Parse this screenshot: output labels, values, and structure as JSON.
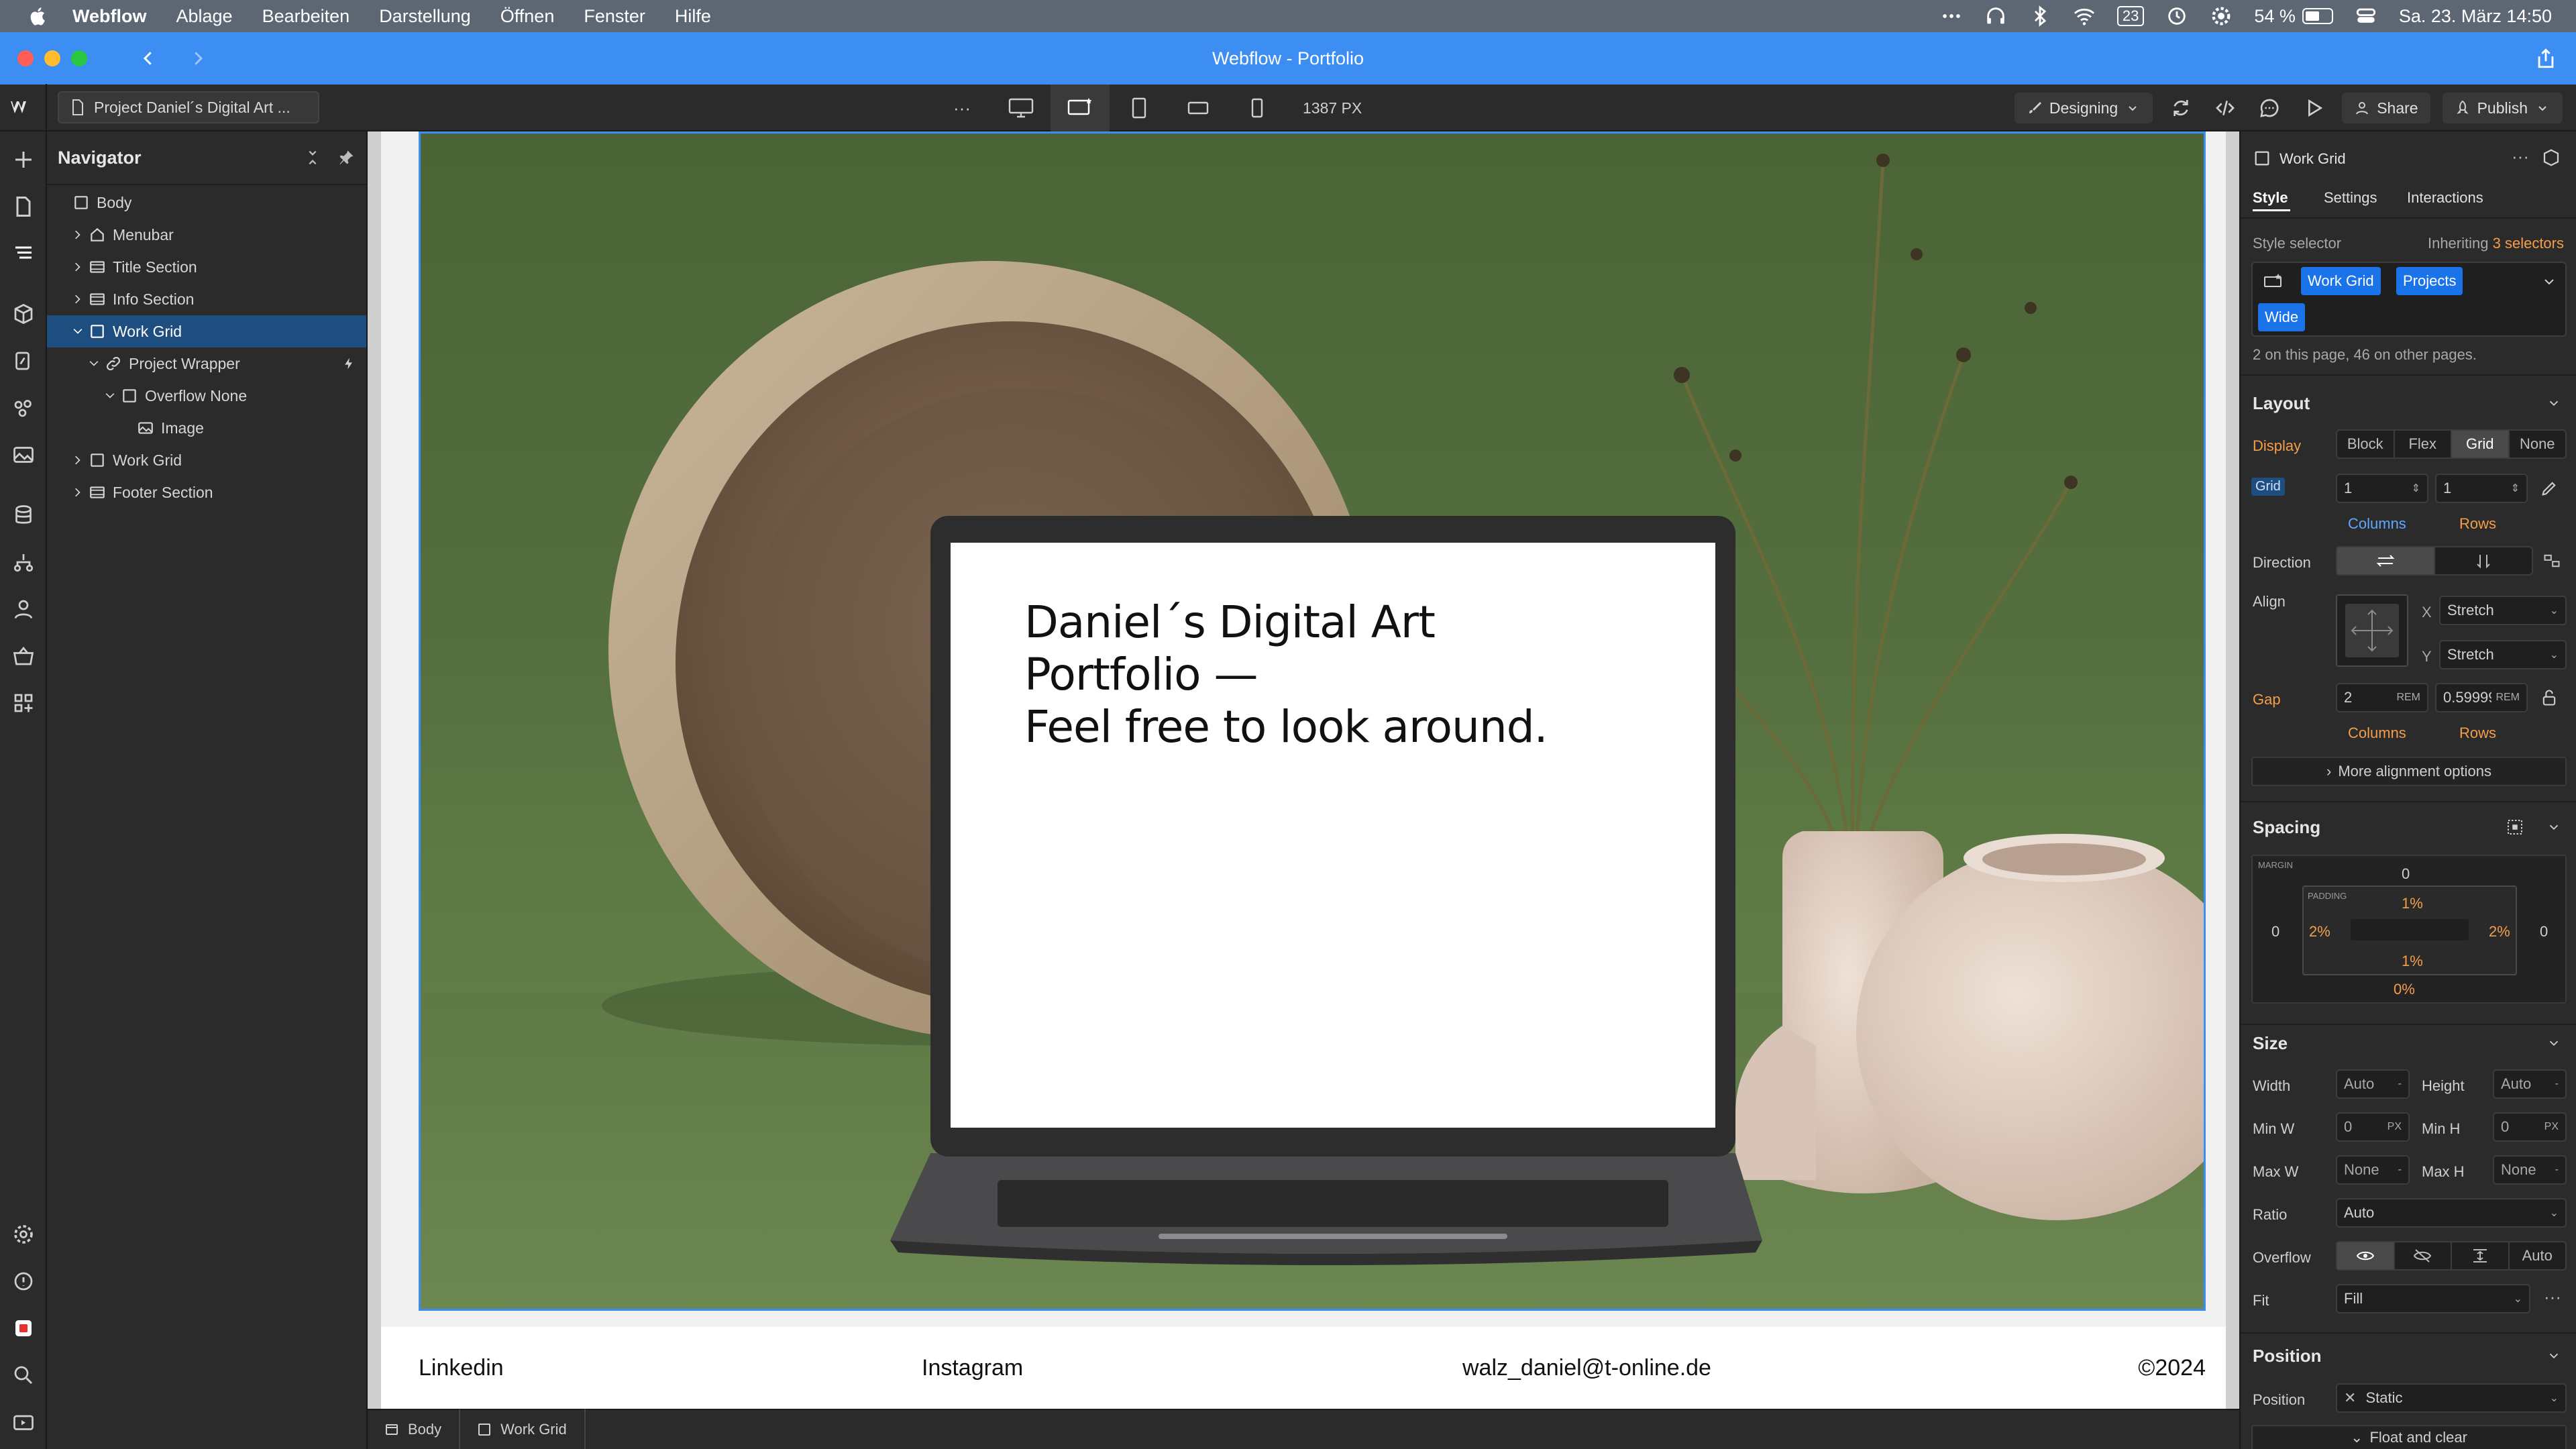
{
  "menubar": {
    "items": [
      "Webflow",
      "Ablage",
      "Bearbeiten",
      "Darstellung",
      "Öffnen",
      "Fenster",
      "Hilfe"
    ],
    "calendar_badge": "23",
    "battery": "54 %",
    "battery_level": 0.54,
    "datetime": "Sa. 23. März  14:50"
  },
  "window": {
    "title": "Webflow - Portfolio"
  },
  "toolbar": {
    "project_tab": "Project Daniel´s Digital Art ...",
    "more": "···",
    "width_readout": "1387 PX",
    "mode": "Designing",
    "share": "Share",
    "publish": "Publish"
  },
  "navigator": {
    "title": "Navigator",
    "items": [
      {
        "label": "Body",
        "depth": 0,
        "chevron": "none",
        "icon": "box"
      },
      {
        "label": "Menubar",
        "depth": 1,
        "chevron": "right",
        "icon": "home"
      },
      {
        "label": "Title Section",
        "depth": 1,
        "chevron": "right",
        "icon": "section"
      },
      {
        "label": "Info Section",
        "depth": 1,
        "chevron": "right",
        "icon": "section"
      },
      {
        "label": "Work Grid",
        "depth": 1,
        "chevron": "down",
        "icon": "box",
        "selected": true
      },
      {
        "label": "Project Wrapper",
        "depth": 2,
        "chevron": "down",
        "icon": "link",
        "bolt": true
      },
      {
        "label": "Overflow None",
        "depth": 3,
        "chevron": "down",
        "icon": "box"
      },
      {
        "label": "Image",
        "depth": 4,
        "chevron": "none",
        "icon": "image"
      },
      {
        "label": "Work Grid",
        "depth": 1,
        "chevron": "right",
        "icon": "box"
      },
      {
        "label": "Footer Section",
        "depth": 1,
        "chevron": "right",
        "icon": "section"
      }
    ]
  },
  "canvas": {
    "hero_text_line1": "Daniel´s Digital Art",
    "hero_text_line2": "Portfolio —",
    "hero_text_line3": "Feel free to look around.",
    "footer": {
      "linkedin": "Linkedin",
      "instagram": "Instagram",
      "email": "walz_daniel@t-online.de",
      "copyright": "©2024"
    }
  },
  "breadcrumbs": [
    "Body",
    "Work Grid"
  ],
  "style_panel": {
    "element_name": "Work Grid",
    "tabs": [
      "Style",
      "Settings",
      "Interactions"
    ],
    "selector_label": "Style selector",
    "inheriting_prefix": "Inheriting",
    "inheriting_count": "3 selectors",
    "selector_chips": [
      "Work Grid",
      "Projects",
      "Wide"
    ],
    "selector_note": "2 on this page, 46 on other pages.",
    "layout": {
      "title": "Layout",
      "display_label": "Display",
      "display_options": [
        "Block",
        "Flex",
        "Grid",
        "None"
      ],
      "display_selected": "Grid",
      "grid_label": "Grid",
      "grid_columns": "1",
      "grid_rows": "1",
      "columns_label": "Columns",
      "rows_label": "Rows",
      "direction_label": "Direction",
      "align_label": "Align",
      "align_x_label": "X",
      "align_x": "Stretch",
      "align_y_label": "Y",
      "align_y": "Stretch",
      "gap_label": "Gap",
      "gap_columns": "2",
      "gap_rows": "0.59999",
      "gap_unit": "REM",
      "more_alignment": "More alignment options"
    },
    "spacing": {
      "title": "Spacing",
      "margin_label": "MARGIN",
      "padding_label": "PADDING",
      "margin_top": "0",
      "margin_left": "0",
      "margin_right": "0",
      "margin_bottom": "0%",
      "padding_top": "1%",
      "padding_left": "2%",
      "padding_right": "2%",
      "padding_bottom": "1%"
    },
    "size": {
      "title": "Size",
      "width_label": "Width",
      "width": "Auto",
      "height_label": "Height",
      "height": "Auto",
      "minw_label": "Min W",
      "minw": "0",
      "minh_label": "Min H",
      "minh": "0",
      "maxw_label": "Max W",
      "maxw": "None",
      "maxh_label": "Max H",
      "maxh": "None",
      "px_unit": "PX",
      "ratio_label": "Ratio",
      "ratio": "Auto",
      "overflow_label": "Overflow",
      "overflow_auto": "Auto",
      "fit_label": "Fit",
      "fit": "Fill"
    },
    "position": {
      "title": "Position",
      "position_label": "Position",
      "position_value": "Static",
      "float_clear": "Float and clear"
    }
  },
  "colors": {
    "titlebar": "#3c8ef2",
    "menubar": "#5d6774",
    "selection": "#1e4d7f",
    "chip": "#1a73e8",
    "accent_orange": "#f59e4a",
    "hero_green": "#556f3f"
  }
}
